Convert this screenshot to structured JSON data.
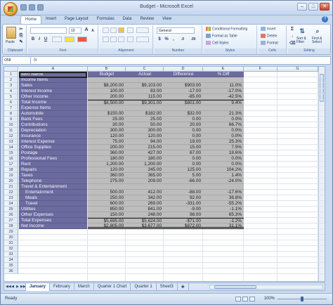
{
  "window": {
    "title": "Budget - Microsoft Excel",
    "minimize": "–",
    "maximize": "□",
    "close": "✕"
  },
  "ribbon": {
    "tabs": [
      "Home",
      "Insert",
      "Page Layout",
      "Formulas",
      "Data",
      "Review",
      "View"
    ],
    "help": "?",
    "clipboard": {
      "paste": "Paste",
      "label": "Clipboard"
    },
    "font": {
      "size": "10",
      "grow": "A",
      "shrink": "A",
      "bold": "B",
      "italic": "I",
      "underline": "U",
      "label": "Font"
    },
    "alignment": {
      "label": "Alignment"
    },
    "number": {
      "format": "General",
      "currency": "$",
      "percent": "%",
      "comma": ",",
      "inc": ".0",
      "dec": ".00",
      "label": "Number"
    },
    "styles": {
      "conditional": "Conditional Formatting",
      "format_table": "Format as Table",
      "cell_styles": "Cell Styles",
      "label": "Styles"
    },
    "cells": {
      "insert": "Insert",
      "delete": "Delete",
      "format": "Format",
      "label": "Cells"
    },
    "editing": {
      "sigma": "Σ",
      "sort": "Sort & Filter",
      "find": "Find & Select",
      "label": "Editing"
    }
  },
  "formula_bar": {
    "name_box": "O58",
    "fx": "fx",
    "content": ""
  },
  "columns": [
    "A",
    "B",
    "C",
    "D",
    "E",
    "F",
    "G"
  ],
  "rows": [
    {
      "n": "1",
      "a": "Item Name",
      "b": "Budget",
      "c": "Actual",
      "d": "Difference",
      "e": "% Diff",
      "header": true
    },
    {
      "n": "2",
      "a": "Income Items",
      "b": "",
      "c": "",
      "d": "",
      "e": ""
    },
    {
      "n": "3",
      "a": "Sales",
      "b": "$8,200.00",
      "c": "$9,103.00",
      "d": "$903.00",
      "e": "11.0%"
    },
    {
      "n": "4",
      "a": "Interest Income",
      "b": "100.00",
      "c": "83.00",
      "d": "-17.00",
      "e": "-17.0%"
    },
    {
      "n": "5",
      "a": "Other Income",
      "b": "200.00",
      "c": "115.00",
      "d": "-85.00",
      "e": "-42.5%"
    },
    {
      "n": "6",
      "a": "Total Income",
      "b": "$8,500.00",
      "c": "$9,301.00",
      "d": "$801.00",
      "e": "9.4%",
      "total": true
    },
    {
      "n": "7",
      "a": "Expense Items",
      "b": "",
      "c": "",
      "d": "",
      "e": ""
    },
    {
      "n": "8",
      "a": "Automobile",
      "b": "$150.00",
      "c": "$182.00",
      "d": "$32.00",
      "e": "21.3%"
    },
    {
      "n": "9",
      "a": "Bank Fees",
      "b": "25.00",
      "c": "25.00",
      "d": "0.00",
      "e": "0.0%"
    },
    {
      "n": "10",
      "a": "Contributions",
      "b": "30.00",
      "c": "50.00",
      "d": "20.00",
      "e": "66.7%"
    },
    {
      "n": "11",
      "a": "Depreciation",
      "b": "300.00",
      "c": "300.00",
      "d": "0.00",
      "e": "0.0%"
    },
    {
      "n": "12",
      "a": "Insurance",
      "b": "120.00",
      "c": "120.00",
      "d": "0.00",
      "e": "0.0%"
    },
    {
      "n": "13",
      "a": "Interest Expense",
      "b": "75.00",
      "c": "94.00",
      "d": "19.00",
      "e": "25.3%"
    },
    {
      "n": "14",
      "a": "Office Supplies",
      "b": "200.00",
      "c": "215.00",
      "d": "15.00",
      "e": "7.5%"
    },
    {
      "n": "15",
      "a": "Postage",
      "b": "360.00",
      "c": "427.00",
      "d": "67.00",
      "e": "18.6%"
    },
    {
      "n": "16",
      "a": "Professional Fees",
      "b": "180.00",
      "c": "180.00",
      "d": "0.00",
      "e": "0.0%"
    },
    {
      "n": "17",
      "a": "Rent",
      "b": "1,200.00",
      "c": "1,200.00",
      "d": "0.00",
      "e": "0.0%"
    },
    {
      "n": "18",
      "a": "Repairs",
      "b": "120.00",
      "c": "245.00",
      "d": "125.00",
      "e": "104.2%"
    },
    {
      "n": "19",
      "a": "Taxes",
      "b": "360.00",
      "c": "365.00",
      "d": "5.00",
      "e": "1.4%"
    },
    {
      "n": "20",
      "a": "Telephone",
      "b": "275.00",
      "c": "209.00",
      "d": "-66.00",
      "e": "-24.0%"
    },
    {
      "n": "21",
      "a": "Travel & Entertainment",
      "b": "",
      "c": "",
      "d": "",
      "e": ""
    },
    {
      "n": "22",
      "a": "Entertainment",
      "b": "500.00",
      "c": "412.00",
      "d": "-88.00",
      "e": "-17.6%",
      "indent": true
    },
    {
      "n": "23",
      "a": "Meals",
      "b": "250.00",
      "c": "342.00",
      "d": "92.00",
      "e": "36.8%",
      "indent": true
    },
    {
      "n": "24",
      "a": "Travel",
      "b": "600.00",
      "c": "269.00",
      "d": "-331.00",
      "e": "-55.2%",
      "indent": true
    },
    {
      "n": "25",
      "a": "Utilities",
      "b": "850.00",
      "c": "841.00",
      "d": "-9.00",
      "e": "-1.1%"
    },
    {
      "n": "26",
      "a": "Other Expenses",
      "b": "150.00",
      "c": "248.00",
      "d": "98.00",
      "e": "65.3%"
    },
    {
      "n": "27",
      "a": "Total Expenses",
      "b": "$5,695.00",
      "c": "$5,624.00",
      "d": "-$71.00",
      "e": "-1.2%",
      "total": true
    },
    {
      "n": "28",
      "a": "Net Income",
      "b": "$2,805.00",
      "c": "$3,677.00",
      "d": "$872.00",
      "e": "31.1%",
      "net": true
    },
    {
      "n": "29"
    },
    {
      "n": "30"
    },
    {
      "n": "31"
    },
    {
      "n": "32"
    },
    {
      "n": "33"
    },
    {
      "n": "34"
    },
    {
      "n": "35"
    },
    {
      "n": "36"
    }
  ],
  "sheets": [
    "January",
    "February",
    "March",
    "Quarter 1 Chart",
    "Quarter 1",
    "Sheet3"
  ],
  "sheet_nav": [
    "◀◀",
    "◀",
    "▶",
    "▶▶"
  ],
  "status": {
    "text": "Ready",
    "zoom": "100%",
    "zoom_fraction": 0.5
  },
  "colors": {
    "label_fill": "#6b6b9f",
    "number_fill": "#bdbdbd",
    "ribbon": "#dde8f6"
  }
}
